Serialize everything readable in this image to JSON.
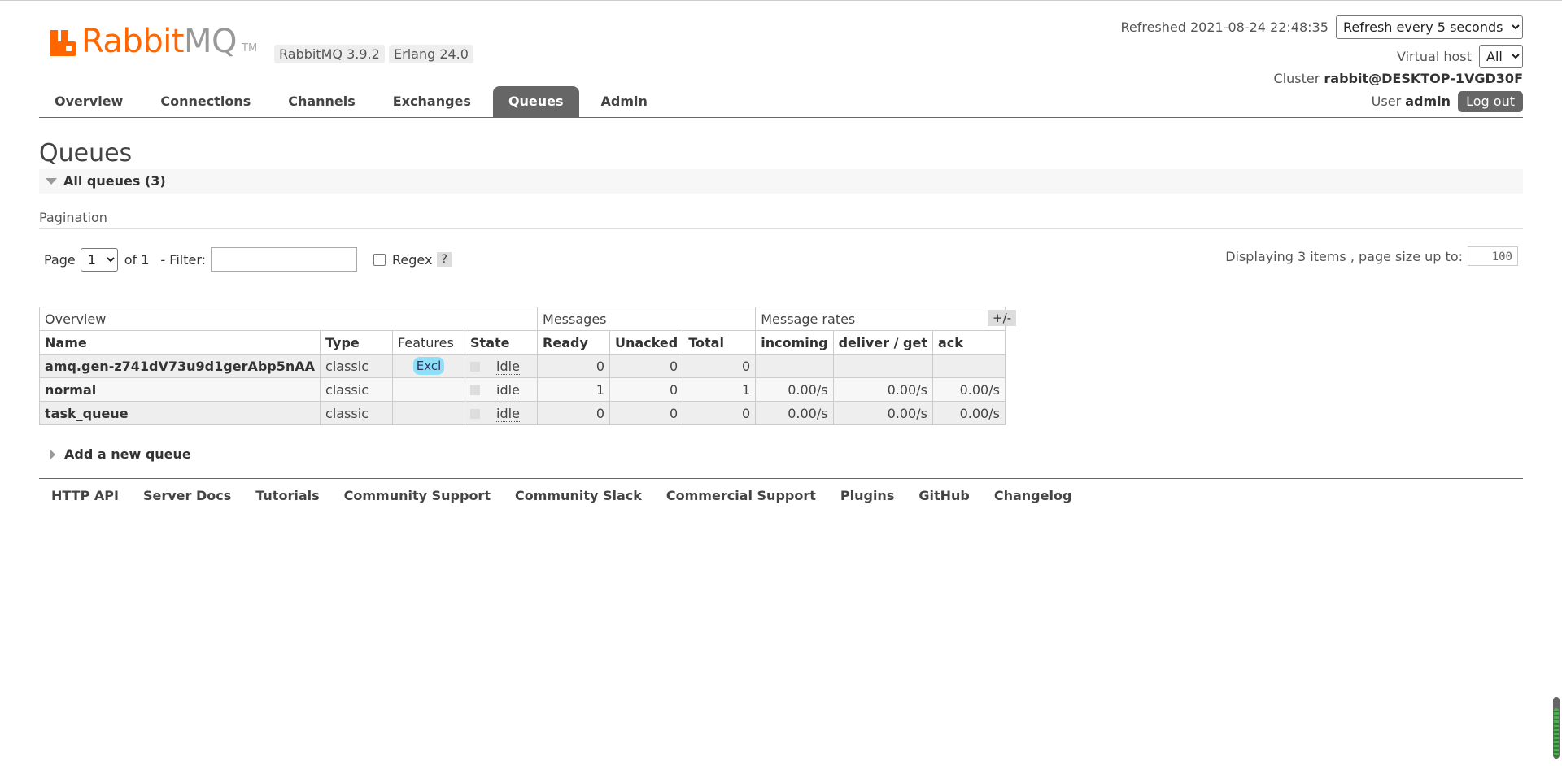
{
  "header": {
    "brand_main": "Rabbit",
    "brand_accent": "MQ",
    "brand_tm": "TM",
    "version_rabbitmq": "RabbitMQ 3.9.2",
    "version_erlang": "Erlang 24.0",
    "refreshed_label": "Refreshed 2021-08-24 22:48:35",
    "refresh_select": "Refresh every 5 seconds",
    "vhost_label": "Virtual host",
    "vhost_select": "All",
    "cluster_label": "Cluster",
    "cluster_name": "rabbit@DESKTOP-1VGD30F",
    "user_label": "User",
    "user_name": "admin",
    "logout_label": "Log out"
  },
  "tabs": [
    {
      "label": "Overview"
    },
    {
      "label": "Connections"
    },
    {
      "label": "Channels"
    },
    {
      "label": "Exchanges"
    },
    {
      "label": "Queues",
      "active": true
    },
    {
      "label": "Admin"
    }
  ],
  "page": {
    "title": "Queues",
    "section_title": "All queues (3)",
    "pagination_label": "Pagination"
  },
  "pagination": {
    "page_label": "Page",
    "page_value": "1",
    "of_label": "of 1",
    "filter_label": "- Filter:",
    "filter_value": "",
    "regex_label": "Regex",
    "help_label": "?",
    "display_label": "Displaying 3 items , page size up to:",
    "page_size": "100"
  },
  "table": {
    "group_headers": {
      "overview": "Overview",
      "messages": "Messages",
      "rates": "Message rates"
    },
    "columns": {
      "name": "Name",
      "type": "Type",
      "features": "Features",
      "state": "State",
      "ready": "Ready",
      "unacked": "Unacked",
      "total": "Total",
      "incoming": "incoming",
      "deliver": "deliver / get",
      "ack": "ack"
    },
    "columns_toggle": "+/-",
    "rows": [
      {
        "name": "amq.gen-z741dV73u9d1gerAbp5nAA",
        "type": "classic",
        "features": "Excl",
        "state": "idle",
        "ready": "0",
        "unacked": "0",
        "total": "0",
        "incoming": "",
        "deliver": "",
        "ack": ""
      },
      {
        "name": "normal",
        "type": "classic",
        "features": "",
        "state": "idle",
        "ready": "1",
        "unacked": "0",
        "total": "1",
        "incoming": "0.00/s",
        "deliver": "0.00/s",
        "ack": "0.00/s"
      },
      {
        "name": "task_queue",
        "type": "classic",
        "features": "",
        "state": "idle",
        "ready": "0",
        "unacked": "0",
        "total": "0",
        "incoming": "0.00/s",
        "deliver": "0.00/s",
        "ack": "0.00/s"
      }
    ]
  },
  "add_queue_label": "Add a new queue",
  "footer": {
    "links": [
      "HTTP API",
      "Server Docs",
      "Tutorials",
      "Community Support",
      "Community Slack",
      "Commercial Support",
      "Plugins",
      "GitHub",
      "Changelog"
    ]
  },
  "colors": {
    "brand": "#ff6600",
    "tab_active": "#666666",
    "feature_badge": "#8ee0f7"
  }
}
